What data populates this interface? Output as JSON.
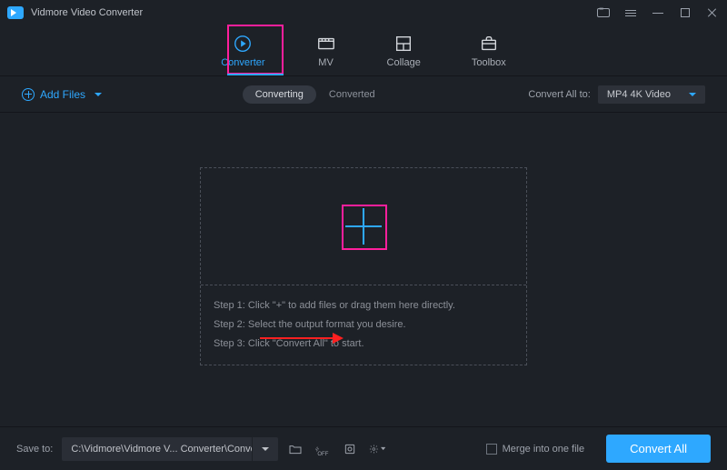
{
  "titlebar": {
    "app_title": "Vidmore Video Converter"
  },
  "tabs": [
    {
      "label": "Converter",
      "active": true
    },
    {
      "label": "MV",
      "active": false
    },
    {
      "label": "Collage",
      "active": false
    },
    {
      "label": "Toolbox",
      "active": false
    }
  ],
  "subbar": {
    "add_files": "Add Files",
    "toggle": [
      "Converting",
      "Converted"
    ],
    "convert_all_to": "Convert All to:",
    "output_format": "MP4 4K Video"
  },
  "instructions": [
    "Step 1: Click \"+\" to add files or drag them here directly.",
    "Step 2: Select the output format you desire.",
    "Step 3: Click \"Convert All\" to start."
  ],
  "footer": {
    "save_to_label": "Save to:",
    "save_path": "C:\\Vidmore\\Vidmore V... Converter\\Converted",
    "merge_label": "Merge into one file",
    "convert_button": "Convert All"
  },
  "colors": {
    "accent": "#2ea8ff",
    "annotation": "#ff1f9c",
    "arrow": "#ff2020",
    "background": "#1d2127"
  }
}
